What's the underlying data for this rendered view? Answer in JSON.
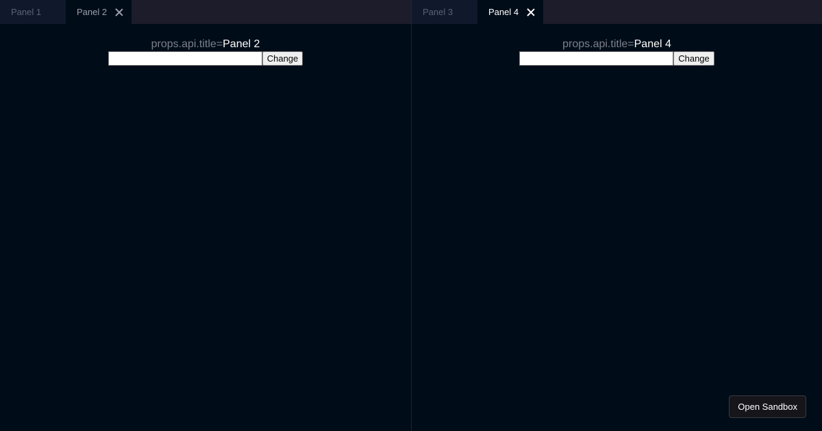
{
  "groups": [
    {
      "tabs": [
        {
          "label": "Panel 1",
          "active": false
        },
        {
          "label": "Panel 2",
          "active": true
        }
      ],
      "content": {
        "key_label": "props.api.title=",
        "value": "Panel 2",
        "input_value": "",
        "button_label": "Change"
      }
    },
    {
      "tabs": [
        {
          "label": "Panel 3",
          "active": false
        },
        {
          "label": "Panel 4",
          "active": true
        }
      ],
      "content": {
        "key_label": "props.api.title=",
        "value": "Panel 4",
        "input_value": "",
        "button_label": "Change"
      }
    }
  ],
  "sandbox": {
    "label": "Open Sandbox"
  },
  "icons": {
    "close": "close-icon"
  },
  "colors": {
    "background": "#000c18",
    "tabbar": "#1c1c2a",
    "inactive_tab": "#10192c"
  }
}
